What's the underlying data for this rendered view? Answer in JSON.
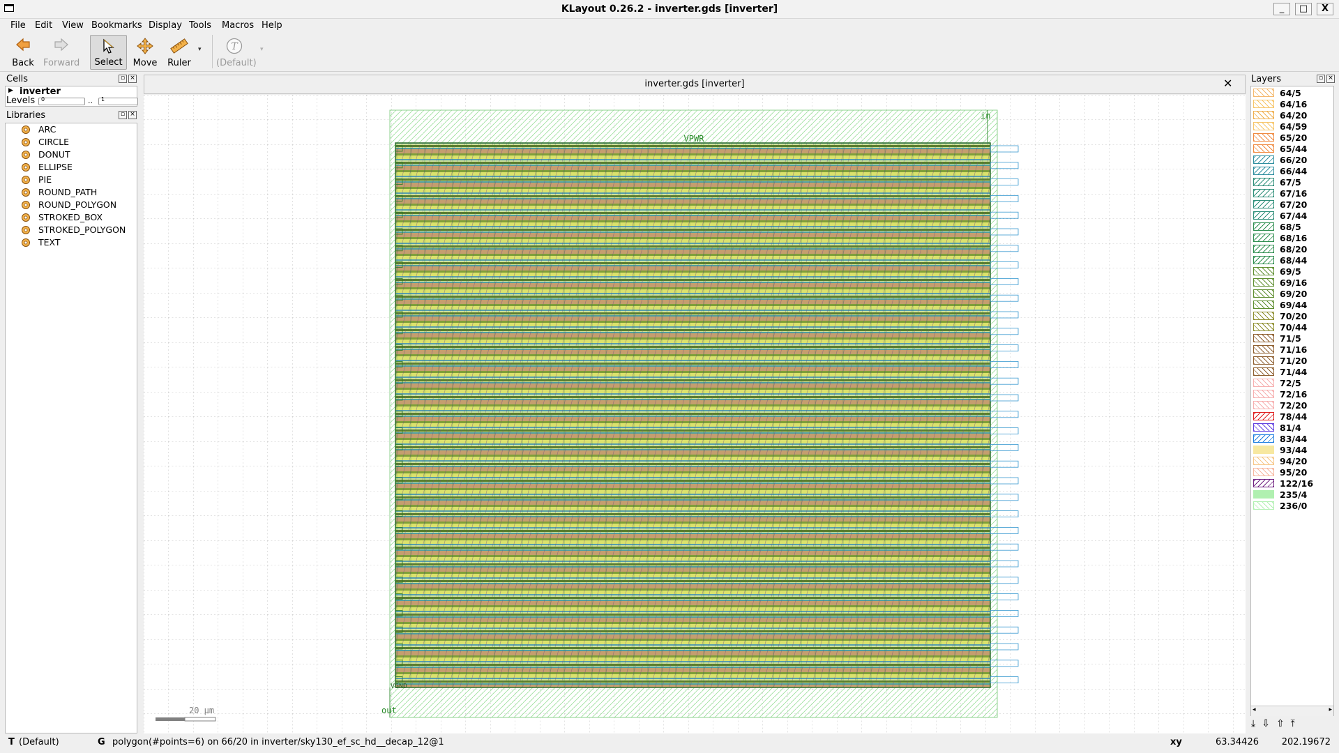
{
  "window": {
    "title": "KLayout 0.26.2 - inverter.gds [inverter]",
    "buttons": {
      "minimize": "_",
      "maximize": "□",
      "close": "X"
    }
  },
  "menu": [
    "File",
    "Edit",
    "View",
    "Bookmarks",
    "Display",
    "Tools",
    "Macros",
    "Help"
  ],
  "toolbar": {
    "back": "Back",
    "forward": "Forward",
    "select": "Select",
    "move": "Move",
    "ruler": "Ruler",
    "text_default": "(Default)"
  },
  "cells_panel": {
    "title": "Cells",
    "tree_item": "inverter",
    "levels_label": "Levels",
    "levels_from": "0",
    "levels_sep": "..",
    "levels_to": "1"
  },
  "libraries_panel": {
    "title": "Libraries",
    "items": [
      "ARC",
      "CIRCLE",
      "DONUT",
      "ELLIPSE",
      "PIE",
      "ROUND_PATH",
      "ROUND_POLYGON",
      "STROKED_BOX",
      "STROKED_POLYGON",
      "TEXT"
    ]
  },
  "view": {
    "tab_title": "inverter.gds [inverter]",
    "close": "✕",
    "labels": {
      "vpwr": "VPWR",
      "in": "in",
      "out": "out",
      "vgnd": "VGND"
    },
    "scale_bar": "20 µm"
  },
  "layers_panel": {
    "title": "Layers",
    "items": [
      {
        "name": "64/5",
        "color": "#f5b96e",
        "pattern": "hatch"
      },
      {
        "name": "64/16",
        "color": "#f7c66a",
        "pattern": "hatch"
      },
      {
        "name": "64/20",
        "color": "#f0b050",
        "pattern": "hatch"
      },
      {
        "name": "64/59",
        "color": "#f7c66a",
        "pattern": "hatch"
      },
      {
        "name": "65/20",
        "color": "#f08a40",
        "pattern": "hatch"
      },
      {
        "name": "65/44",
        "color": "#f08a40",
        "pattern": "hatch"
      },
      {
        "name": "66/20",
        "color": "#2f8fa0",
        "pattern": "backhatch"
      },
      {
        "name": "66/44",
        "color": "#2f8fa0",
        "pattern": "backhatch"
      },
      {
        "name": "67/5",
        "color": "#2f8f7a",
        "pattern": "backhatch"
      },
      {
        "name": "67/16",
        "color": "#2f8f7a",
        "pattern": "backhatch"
      },
      {
        "name": "67/20",
        "color": "#2f8f7a",
        "pattern": "backhatch"
      },
      {
        "name": "67/44",
        "color": "#2f8f7a",
        "pattern": "backhatch"
      },
      {
        "name": "68/5",
        "color": "#2f8f50",
        "pattern": "backhatch"
      },
      {
        "name": "68/16",
        "color": "#2f8f50",
        "pattern": "backhatch"
      },
      {
        "name": "68/20",
        "color": "#2f8f50",
        "pattern": "backhatch"
      },
      {
        "name": "68/44",
        "color": "#2f8f50",
        "pattern": "backhatch"
      },
      {
        "name": "69/5",
        "color": "#5f8f30",
        "pattern": "hatch"
      },
      {
        "name": "69/16",
        "color": "#5f8f30",
        "pattern": "hatch"
      },
      {
        "name": "69/20",
        "color": "#5f8f30",
        "pattern": "hatch"
      },
      {
        "name": "69/44",
        "color": "#5f8f30",
        "pattern": "hatch"
      },
      {
        "name": "70/20",
        "color": "#8f8f30",
        "pattern": "hatch"
      },
      {
        "name": "70/44",
        "color": "#8f8f30",
        "pattern": "hatch"
      },
      {
        "name": "71/5",
        "color": "#8f5f30",
        "pattern": "hatch"
      },
      {
        "name": "71/16",
        "color": "#8f5f30",
        "pattern": "hatch"
      },
      {
        "name": "71/20",
        "color": "#8f5f30",
        "pattern": "hatch"
      },
      {
        "name": "71/44",
        "color": "#8f5f30",
        "pattern": "hatch"
      },
      {
        "name": "72/5",
        "color": "#f7b0b0",
        "pattern": "hatch"
      },
      {
        "name": "72/16",
        "color": "#f7b0b0",
        "pattern": "hatch"
      },
      {
        "name": "72/20",
        "color": "#f7b0b0",
        "pattern": "hatch"
      },
      {
        "name": "78/44",
        "color": "#e02020",
        "pattern": "backhatch"
      },
      {
        "name": "81/4",
        "color": "#6040e0",
        "pattern": "hatch"
      },
      {
        "name": "83/44",
        "color": "#2080e0",
        "pattern": "backhatch"
      },
      {
        "name": "93/44",
        "color": "#f7e8a0",
        "pattern": "none"
      },
      {
        "name": "94/20",
        "color": "#f7c88a",
        "pattern": "hatch"
      },
      {
        "name": "95/20",
        "color": "#f7b8a0",
        "pattern": "hatch"
      },
      {
        "name": "122/16",
        "color": "#702080",
        "pattern": "backhatch"
      },
      {
        "name": "235/4",
        "color": "#b0f0b0",
        "pattern": "none"
      },
      {
        "name": "236/0",
        "color": "#b0f0b0",
        "pattern": "hatch"
      }
    ]
  },
  "status": {
    "mode_key": "T",
    "mode_value": "(Default)",
    "grid_key": "G",
    "message": "polygon(#points=6) on 66/20 in inverter/sky130_ef_sc_hd__decap_12@1",
    "coord_label": "xy",
    "x": "63.34426",
    "y": "202.19672"
  }
}
